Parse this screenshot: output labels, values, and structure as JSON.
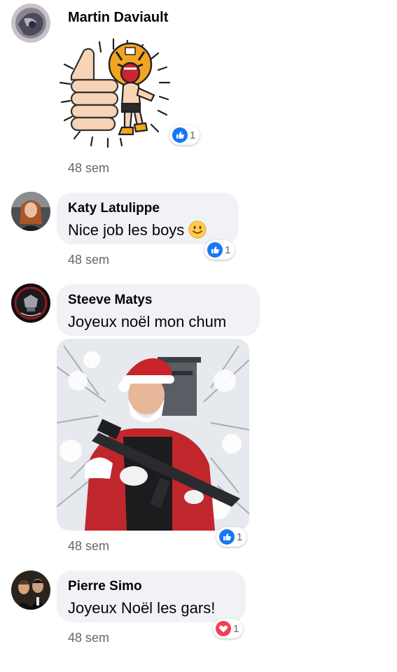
{
  "comments": [
    {
      "author": "Martin Daviault",
      "type": "sticker",
      "sticker_icon": "thumbs-up-tiger-sticker",
      "reaction": {
        "icon": "like-icon",
        "count": "1"
      },
      "time": "48 sem"
    },
    {
      "author": "Katy Latulippe",
      "text": "Nice job les boys",
      "emoji_icon": "smiley-icon",
      "reaction": {
        "icon": "like-icon",
        "count": "1"
      },
      "time": "48 sem"
    },
    {
      "author": "Steeve Matys",
      "text": "Joyeux noël mon chum",
      "image_icon": "santa-with-rifle-photo",
      "reaction": {
        "icon": "like-icon",
        "count": "1"
      },
      "time": "48 sem"
    },
    {
      "author": "Pierre Simo",
      "text": "Joyeux Noël les gars!",
      "reaction": {
        "icon": "love-icon",
        "count": "1"
      },
      "time": "48 sem"
    }
  ],
  "colors": {
    "bubble": "#f0f2f5",
    "like_blue": "#1877f2",
    "love_red": "#f33e58",
    "meta_gray": "#65676b"
  }
}
